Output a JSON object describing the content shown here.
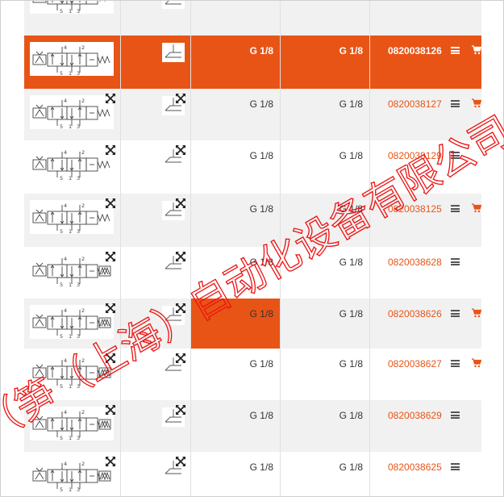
{
  "table": {
    "rows": [
      {
        "port1": "",
        "port2": "",
        "part_number": "",
        "show_menu": false,
        "show_cart": false,
        "style": "alt",
        "show_zoom": false
      },
      {
        "port1": "G 1/8",
        "port2": "G 1/8",
        "part_number": "0820038126",
        "show_menu": true,
        "show_cart": true,
        "style": "highlight",
        "show_zoom": false
      },
      {
        "port1": "G 1/8",
        "port2": "G 1/8",
        "part_number": "0820038127",
        "show_menu": true,
        "show_cart": true,
        "style": "alt",
        "show_zoom": true
      },
      {
        "port1": "G 1/8",
        "port2": "G 1/8",
        "part_number": "0820038129",
        "show_menu": true,
        "show_cart": false,
        "style": "plain",
        "show_zoom": true
      },
      {
        "port1": "G 1/8",
        "port2": "G 1/8",
        "part_number": "0820038125",
        "show_menu": true,
        "show_cart": true,
        "style": "alt",
        "show_zoom": true
      },
      {
        "port1": "G 1/8",
        "port2": "G 1/8",
        "part_number": "0820038628",
        "show_menu": true,
        "show_cart": false,
        "style": "plain",
        "show_zoom": true
      },
      {
        "port1": "G 1/8",
        "port2": "G 1/8",
        "part_number": "0820038626",
        "show_menu": true,
        "show_cart": true,
        "style": "alt",
        "show_zoom": true
      },
      {
        "port1": "G 1/8",
        "port2": "G 1/8",
        "part_number": "0820038627",
        "show_menu": true,
        "show_cart": true,
        "style": "plain",
        "show_zoom": true
      },
      {
        "port1": "G 1/8",
        "port2": "G 1/8",
        "part_number": "0820038629",
        "show_menu": true,
        "show_cart": false,
        "style": "alt",
        "show_zoom": true
      },
      {
        "port1": "G 1/8",
        "port2": "G 1/8",
        "part_number": "0820038625",
        "show_menu": true,
        "show_cart": false,
        "style": "plain",
        "show_zoom": true
      }
    ]
  },
  "watermark": {
    "line1": "（笋（上海）自动化设备有限公司",
    "color": "#ee1111"
  },
  "icons": {
    "zoom": "expand-arrows-icon",
    "menu": "hamburger-menu-icon",
    "cart": "shopping-cart-icon",
    "valve_symbol": "valve-schematic-icon",
    "mini_symbol": "actuator-symbol-icon"
  },
  "colors": {
    "accent": "#e85416",
    "row_alt": "#f1f1f1",
    "text": "#333333",
    "link": "#e85416"
  }
}
